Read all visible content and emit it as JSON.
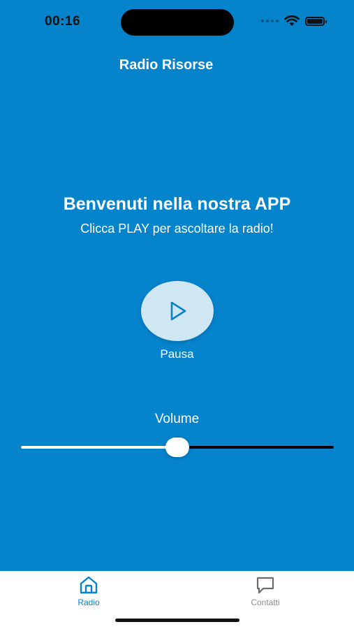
{
  "status_bar": {
    "time": "00:16",
    "icons": [
      "signal-dots-icon",
      "wifi-icon",
      "battery-icon"
    ]
  },
  "header": {
    "title": "Radio Risorse"
  },
  "main": {
    "welcome_title": "Benvenuti nella nostra APP",
    "welcome_subtitle": "Clicca PLAY per ascoltare la radio!",
    "play_button_icon": "play-icon",
    "play_label": "Pausa",
    "volume_label": "Volume",
    "volume_value": 0.5
  },
  "tab_bar": {
    "tabs": [
      {
        "label": "Radio",
        "icon": "home-icon",
        "active": true
      },
      {
        "label": "Contatti",
        "icon": "chat-bubble-icon",
        "active": false
      }
    ]
  },
  "colors": {
    "background": "#0583cb",
    "accent": "#0583cb",
    "play_button": "#cfe6f3",
    "tab_inactive": "#8a8a8a"
  }
}
